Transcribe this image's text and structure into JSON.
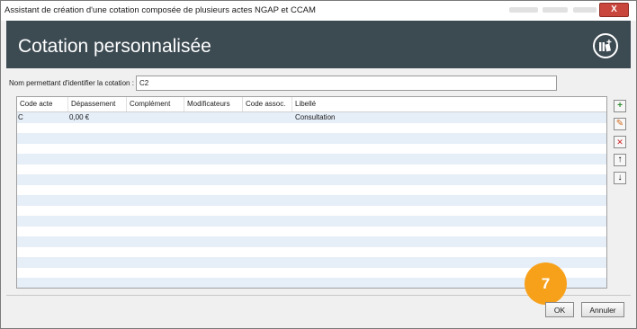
{
  "window": {
    "title": "Assistant de création d'une cotation composée de plusieurs actes NGAP et CCAM",
    "close_label": "X"
  },
  "header": {
    "title": "Cotation personnalisée",
    "icon": "medical-bag-plus-icon"
  },
  "form": {
    "name_label": "Nom permettant d'identifier la cotation :",
    "name_value": "C2"
  },
  "grid": {
    "columns": [
      "Code acte",
      "Dépassement",
      "Complément",
      "Modificateurs",
      "Code assoc.",
      "Libellé"
    ],
    "rows": [
      {
        "code_acte": "C",
        "depassement": "0,00 €",
        "complement": "",
        "modificateurs": "",
        "code_assoc": "",
        "libelle": "Consultation"
      }
    ]
  },
  "side_tools": [
    {
      "name": "add-row-icon",
      "glyph": "+"
    },
    {
      "name": "edit-row-icon",
      "glyph": "✎"
    },
    {
      "name": "delete-row-icon",
      "glyph": "✕"
    },
    {
      "name": "move-up-icon",
      "glyph": "↑"
    },
    {
      "name": "move-down-icon",
      "glyph": "↓"
    }
  ],
  "badge": {
    "text": "7",
    "color": "#f7a11b"
  },
  "buttons": {
    "ok": "OK",
    "cancel": "Annuler"
  },
  "colors": {
    "header_bg": "#3c4a52",
    "row_alt": "#e6eef8",
    "close_bg": "#c9463d"
  }
}
